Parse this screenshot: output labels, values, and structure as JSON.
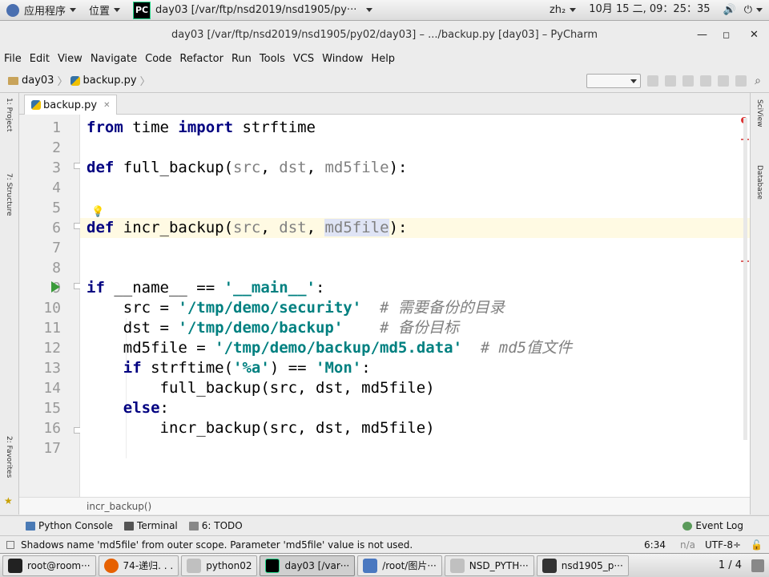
{
  "topbar": {
    "apps": "应用程序",
    "places": "位置",
    "window_title": "day03 [/var/ftp/nsd2019/nsd1905/py···",
    "input_method": "zh₂",
    "clock": "10月 15 二, 09：25：35"
  },
  "window": {
    "title": "day03 [/var/ftp/nsd2019/nsd1905/py02/day03] – .../backup.py [day03] – PyCharm"
  },
  "menu": [
    "File",
    "Edit",
    "View",
    "Navigate",
    "Code",
    "Refactor",
    "Run",
    "Tools",
    "VCS",
    "Window",
    "Help"
  ],
  "nav": {
    "project": "day03",
    "file": "backup.py"
  },
  "tab": {
    "label": "backup.py"
  },
  "left_tools": {
    "project": "1: Project",
    "structure": "7: Structure",
    "favorites": "2: Favorites"
  },
  "right_tools": {
    "scview": "SciView",
    "database": "Database"
  },
  "lines": [
    "1",
    "2",
    "3",
    "4",
    "5",
    "6",
    "7",
    "8",
    "9",
    "10",
    "11",
    "12",
    "13",
    "14",
    "15",
    "16",
    "17"
  ],
  "code": {
    "l1": {
      "a": "from",
      "b": " time ",
      "c": "import",
      "d": " strftime"
    },
    "l3": {
      "a": "def",
      "b": " full_backup(",
      "p1": "src",
      "s1": ", ",
      "p2": "dst",
      "s2": ", ",
      "p3": "md5file",
      "e": "):"
    },
    "l6": {
      "a": "def",
      "b": " incr_backup(",
      "p1": "src",
      "s1": ", ",
      "p2": "dst",
      "s2": ", ",
      "p3": "md5file",
      "e": "):"
    },
    "l9": {
      "a": "if",
      "b": " __name__ == ",
      "s": "'__main__'",
      "e": ":"
    },
    "l10": {
      "a": "    src = ",
      "s": "'/tmp/demo/security'",
      "c": "  # 需要备份的目录"
    },
    "l11": {
      "a": "    dst = ",
      "s": "'/tmp/demo/backup'",
      "c": "    # 备份目标"
    },
    "l12": {
      "a": "    md5file = ",
      "s": "'/tmp/demo/backup/md5.data'",
      "c": "  # md5值文件"
    },
    "l13": {
      "a": "    ",
      "k": "if",
      "b": " strftime(",
      "s1": "'%a'",
      "m": ") == ",
      "s2": "'Mon'",
      "e": ":"
    },
    "l14": "        full_backup(src, dst, md5file)",
    "l15": {
      "a": "    ",
      "k": "else",
      "e": ":"
    },
    "l16": "        incr_backup(src, dst, md5file)"
  },
  "editor_breadcrumb": "incr_backup()",
  "toolwindows": {
    "console": "Python Console",
    "terminal": "Terminal",
    "todo": "6: TODO",
    "eventlog": "Event Log"
  },
  "status": {
    "message": "Shadows name 'md5file' from outer scope. Parameter 'md5file' value is not used.",
    "position": "6:34",
    "na": "n/a",
    "encoding": "UTF-8÷"
  },
  "taskbar": {
    "items": [
      "root@room···",
      "74-递归. . .",
      "python02",
      "day03 [/var···",
      "/root/图片···",
      "NSD_PYTH···",
      "nsd1905_p···"
    ],
    "pager": "1 / 4"
  },
  "colors": {
    "keyword": "#000080",
    "string": "#008080",
    "comment": "#808080",
    "param": "#808080"
  }
}
